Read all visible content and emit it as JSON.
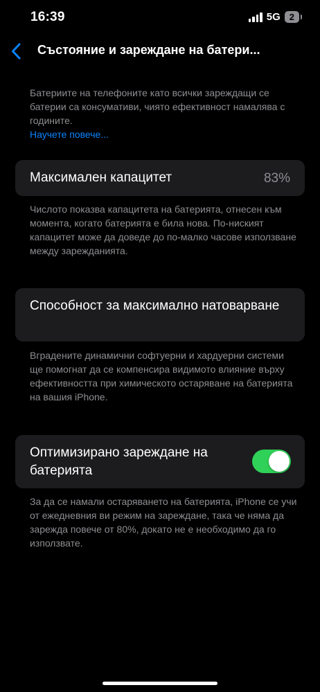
{
  "status_bar": {
    "time": "16:39",
    "network": "5G",
    "battery_badge": "2"
  },
  "nav": {
    "title": "Състояние и зареждане на батери..."
  },
  "intro": {
    "text": "Батериите на телефоните като всички зареждащи се батерии са консумативи, чиято ефективност намалява с годините.",
    "link": "Научете повече..."
  },
  "max_capacity": {
    "label": "Максимален капацитет",
    "value": "83%",
    "footnote": "Числото показва капацитета на батерията, отнесен към момента, когато батерията е била нова. По-ниският капацитет може да доведе до по-малко часове използване между зарежданията."
  },
  "peak_performance": {
    "label": "Способност за максимално натоварване",
    "footnote": "Вградените динамични софтуерни и хардуерни системи ще помогнат да се компенсира видимото влияние върху ефективността при химическото остаряване на батерията на вашия iPhone."
  },
  "optimized_charging": {
    "label": "Оптимизирано зареждане на батерията",
    "enabled": true,
    "footnote": "За да се намали остаряването на батерията, iPhone се учи от ежедневния ви режим на зареждане, така че няма да зарежда повече от 80%, докато не е необходимо да го използвате."
  },
  "colors": {
    "accent": "#0a84ff",
    "toggle_on": "#30d158",
    "card": "#1c1c1e",
    "secondary_text": "#8e8e93"
  },
  "icons": {
    "back": "chevron-left-icon",
    "signal": "cellular-signal-icon",
    "battery": "battery-icon"
  }
}
